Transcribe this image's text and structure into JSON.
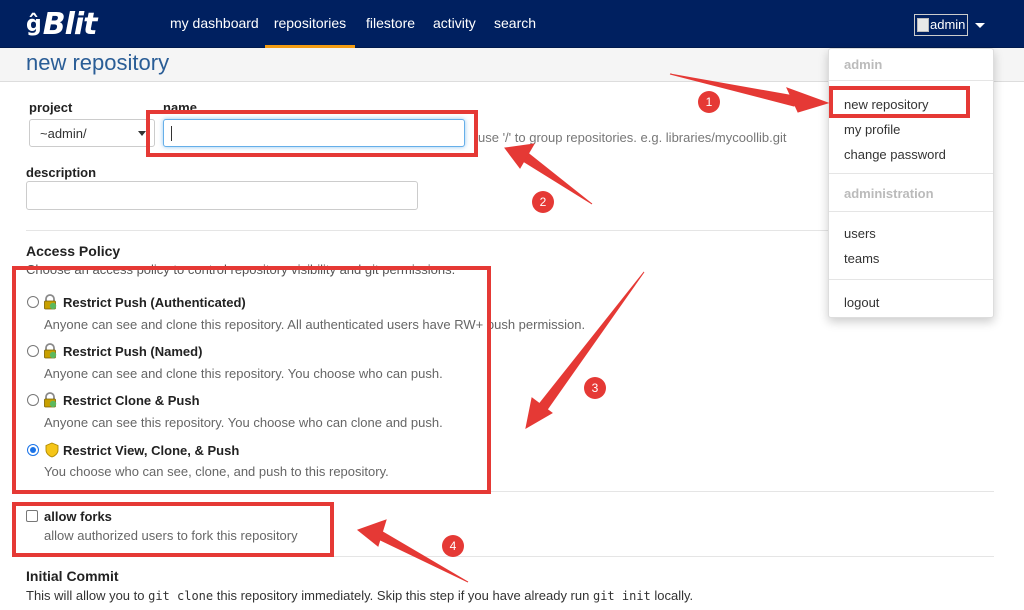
{
  "nav": {
    "brand": "Blit",
    "brand_glyph": "ĝ",
    "items": [
      {
        "label": "my dashboard"
      },
      {
        "label": "repositories"
      },
      {
        "label": "filestore"
      },
      {
        "label": "activity"
      },
      {
        "label": "search"
      }
    ],
    "active_item": "repositories",
    "user_label": "admin"
  },
  "page": {
    "title": "new repository"
  },
  "form": {
    "project_label": "project",
    "project_value": "~admin/",
    "name_label": "name",
    "name_value": "",
    "name_hint": "use '/' to group repositories. e.g. libraries/mycoollib.git",
    "description_label": "description",
    "description_value": ""
  },
  "access_policy": {
    "title": "Access Policy",
    "subtitle": "Choose an access policy to control repository visibility and git permissions.",
    "options": [
      {
        "title": "Restrict Push (Authenticated)",
        "description": "Anyone can see and clone this repository. All authenticated users have RW+ push permission.",
        "checked": false
      },
      {
        "title": "Restrict Push (Named)",
        "description": "Anyone can see and clone this repository. You choose who can push.",
        "checked": false
      },
      {
        "title": "Restrict Clone & Push",
        "description": "Anyone can see this repository. You choose who can clone and push.",
        "checked": false
      },
      {
        "title": "Restrict View, Clone, & Push",
        "description": "You choose who can see, clone, and push to this repository.",
        "checked": true
      }
    ]
  },
  "forks": {
    "label": "allow forks",
    "description": "allow authorized users to fork this repository",
    "checked": false
  },
  "initial_commit": {
    "title": "Initial Commit",
    "text_before": "This will allow you to ",
    "code1": "git clone",
    "text_middle": " this repository immediately. Skip this step if you have already run ",
    "code2": "git init",
    "text_after": " locally."
  },
  "dropdown": {
    "header_user": "admin",
    "user_items": [
      {
        "label": "new repository"
      },
      {
        "label": "my profile"
      },
      {
        "label": "change password"
      }
    ],
    "header_admin": "administration",
    "admin_items": [
      {
        "label": "users"
      },
      {
        "label": "teams"
      }
    ],
    "logout": "logout"
  },
  "annotations": {
    "badges": [
      "1",
      "2",
      "3",
      "4"
    ],
    "color": "#e53935"
  },
  "colors": {
    "navbar": "#002060",
    "active_tab": "#f39c12",
    "title": "#2a5d96"
  }
}
